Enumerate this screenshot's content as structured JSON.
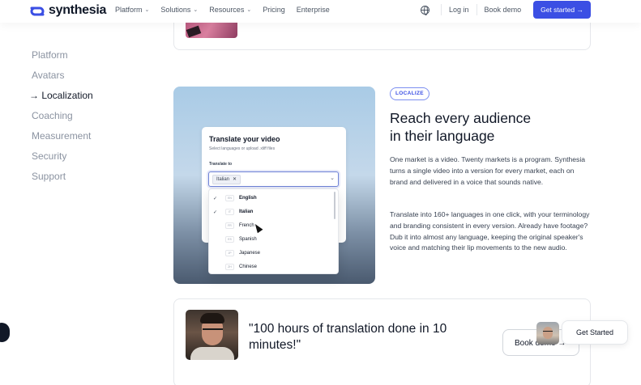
{
  "header": {
    "brand": "synthesia",
    "nav": [
      {
        "label": "Platform",
        "has_menu": true
      },
      {
        "label": "Solutions",
        "has_menu": true
      },
      {
        "label": "Resources",
        "has_menu": true
      },
      {
        "label": "Pricing",
        "has_menu": false
      },
      {
        "label": "Enterprise",
        "has_menu": false
      }
    ],
    "chevron": "⌄",
    "login": "Log in",
    "book_demo": "Book demo",
    "cta": "Get started →",
    "accent_color": "#3b4fe4"
  },
  "sidebar": {
    "items": [
      {
        "label": "Platform"
      },
      {
        "label": "Avatars"
      },
      {
        "label": "→ Localization"
      },
      {
        "label": "Coaching"
      },
      {
        "label": "Measurement"
      },
      {
        "label": "Security"
      },
      {
        "label": "Support"
      }
    ]
  },
  "translate_card": {
    "title": "Translate your video",
    "subtitle": "Select languages or upload .xliff files",
    "label": "Translate to",
    "chip": "Italian",
    "chip_remove": "✕",
    "chevron": "⌄",
    "options": [
      {
        "check": "✓",
        "code": "EN",
        "name": "English"
      },
      {
        "check": "✓",
        "code": "IT",
        "name": "Italian"
      },
      {
        "check": "",
        "code": "FR",
        "name": "French"
      },
      {
        "check": "",
        "code": "ES",
        "name": "Spanish"
      },
      {
        "check": "",
        "code": "JP",
        "name": "Japanese"
      },
      {
        "check": "",
        "code": "ZH",
        "name": "Chinese"
      }
    ]
  },
  "localize": {
    "badge": "LOCALIZE",
    "headline_line1": "Reach every audience",
    "headline_line2": "in their language",
    "para1": "One market is a video. Twenty markets is a program. Synthesia turns a single video into a version for every market, each on brand and delivered in a voice that sounds native.",
    "para2": "Translate into 160+ languages in one click, with your terminology and branding consistent in every version. Already have footage? Dub it into almost any language, keeping the original speaker's voice and matching their lip movements to the new audio."
  },
  "testimonial": {
    "quote": "\"100 hours of translation done in 10 minutes!\""
  },
  "floating": {
    "book_demo": "Book demo →",
    "get_started": "Get Started"
  }
}
